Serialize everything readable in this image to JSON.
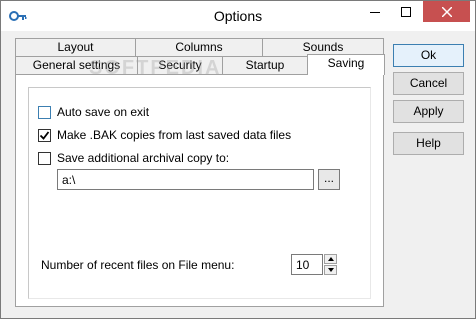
{
  "window": {
    "title": "Options"
  },
  "tabs": {
    "back_row": [
      "Layout",
      "Columns",
      "Sounds"
    ],
    "front_row": [
      "General settings",
      "Security",
      "Startup",
      "Saving"
    ],
    "active": "Saving"
  },
  "saving": {
    "auto_save_label": "Auto save on exit",
    "auto_save_checked": false,
    "bak_label": "Make .BAK copies from last saved data files",
    "bak_checked": true,
    "archival_label": "Save additional archival copy to:",
    "archival_checked": false,
    "archival_path": "a:\\",
    "browse_label": "...",
    "recent_files_label": "Number of recent files on File menu:",
    "recent_files_value": "10"
  },
  "buttons": {
    "ok": "Ok",
    "cancel": "Cancel",
    "apply": "Apply",
    "help": "Help"
  },
  "watermark": "SOFTPEDIA"
}
